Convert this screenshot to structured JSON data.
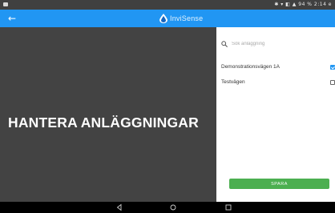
{
  "status_bar": {
    "right_text": "✱ ▾ ◧ ▲ 94 % 2:14 e"
  },
  "app_bar": {
    "logo_text": "InviSense",
    "logo_color": "#1565c0"
  },
  "main": {
    "title": "HANTERA ANLÄGGNINGAR"
  },
  "panel": {
    "search_placeholder": "Sök anläggning",
    "items": [
      {
        "label": "Demonstrationsvägen 1A",
        "checked": true
      },
      {
        "label": "Testvägen",
        "checked": false
      }
    ],
    "save_label": "SPARA"
  },
  "colors": {
    "app_bar": "#2196f3",
    "save_button": "#4caf50",
    "left_panel": "#434343"
  },
  "nav": {
    "icons": [
      "back-icon",
      "home-icon",
      "recents-icon"
    ]
  }
}
